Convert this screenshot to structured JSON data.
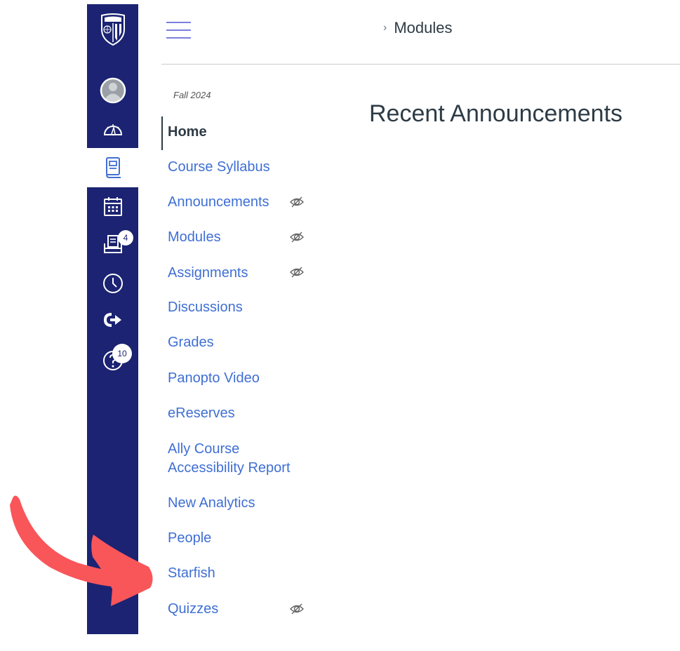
{
  "global_nav": {
    "items": [
      {
        "name": "logo",
        "icon": "university-shield-logo"
      },
      {
        "name": "account",
        "icon": "user-avatar-icon"
      },
      {
        "name": "dashboard",
        "icon": "speedometer-icon"
      },
      {
        "name": "courses",
        "icon": "book-icon",
        "active": true
      },
      {
        "name": "calendar",
        "icon": "calendar-icon"
      },
      {
        "name": "inbox",
        "icon": "inbox-icon",
        "badge": "4"
      },
      {
        "name": "history",
        "icon": "clock-icon"
      },
      {
        "name": "commons",
        "icon": "arrow-share-icon"
      },
      {
        "name": "help",
        "icon": "help-icon",
        "badge": "10"
      }
    ],
    "colors": {
      "background": "#1b2372",
      "active_icon": "#3f6fd4"
    }
  },
  "header": {
    "breadcrumb_separator": "›",
    "breadcrumb_current": "Modules"
  },
  "course_nav": {
    "term": "Fall 2024",
    "items": [
      {
        "label": "Home",
        "active": true,
        "hidden": false
      },
      {
        "label": "Course Syllabus",
        "hidden": false
      },
      {
        "label": "Announcements",
        "hidden": true
      },
      {
        "label": "Modules",
        "hidden": true
      },
      {
        "label": "Assignments",
        "hidden": true
      },
      {
        "label": "Discussions",
        "hidden": false
      },
      {
        "label": "Grades",
        "hidden": false
      },
      {
        "label": "Panopto Video",
        "hidden": false
      },
      {
        "label": "eReserves",
        "hidden": false
      },
      {
        "label": "Ally Course Accessibility Report",
        "line1": "Ally Course",
        "line2": "Accessibility Report",
        "hidden": false
      },
      {
        "label": "New Analytics",
        "hidden": false
      },
      {
        "label": "People",
        "hidden": false
      },
      {
        "label": "Starfish",
        "hidden": false,
        "highlighted_by_arrow": true
      },
      {
        "label": "Quizzes",
        "hidden": true
      }
    ],
    "colors": {
      "link": "#3f6fd4",
      "active": "#2d3b45"
    }
  },
  "main": {
    "title": "Recent Announcements"
  },
  "annotation": {
    "type": "curved-arrow",
    "points_to": "Starfish",
    "color": "#f9565a"
  }
}
